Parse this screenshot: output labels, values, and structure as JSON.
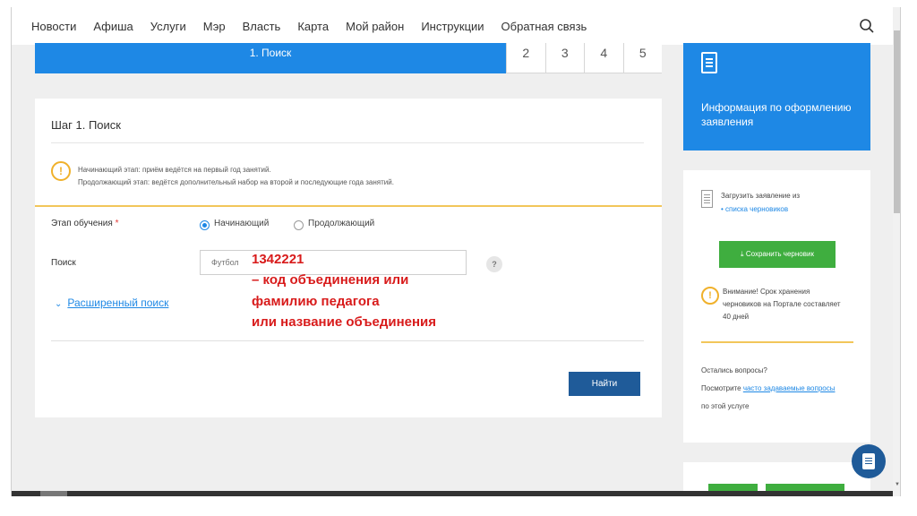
{
  "nav": {
    "items": [
      "Новости",
      "Афиша",
      "Услуги",
      "Мэр",
      "Власть",
      "Карта",
      "Мой район",
      "Инструкции",
      "Обратная связь"
    ]
  },
  "steps": {
    "active_label": "1. Поиск",
    "others": [
      "2",
      "3",
      "4",
      "5"
    ]
  },
  "form": {
    "title": "Шаг 1. Поиск",
    "info_icon": "!",
    "info_line1": "Начинающий этап: приём ведётся на первый год занятий.",
    "info_line2": "Продолжающий этап: ведётся дополнительный набор на второй и последующие года занятий.",
    "stage_label": "Этап обучения",
    "required_mark": "*",
    "stage_options": [
      "Начинающий",
      "Продолжающий"
    ],
    "stage_selected": "Начинающий",
    "search_label": "Поиск",
    "search_placeholder": "Футбол",
    "help_icon": "?",
    "advanced_search": "Расширенный поиск",
    "advanced_chevron": "⌄",
    "find_button": "Найти"
  },
  "annotation": {
    "line1": "1342221",
    "line2": "– код объединения или",
    "line3": "фамилию педагога",
    "line4": "или название объединения"
  },
  "sidebar": {
    "info_title": "Информация по оформлению заявления",
    "draft_text": "Загрузить заявление из",
    "draft_link": "списка черновиков",
    "save_button": "Сохранить черновик",
    "warn_icon": "!",
    "warn_line1": "Внимание! Срок хранения",
    "warn_line2": "черновиков на Портале составляет",
    "warn_line3": "40 дней",
    "questions": "Остались вопросы?",
    "see_prefix": "Посмотрите",
    "faq_link": "часто задаваемые вопросы",
    "about_service": "по этой услуге"
  },
  "colors": {
    "accent_blue": "#1e88e5",
    "dark_blue": "#1f5b99",
    "green": "#3fae3f",
    "warning_yellow": "#f0b12b",
    "annotation_red": "#d81b1b"
  }
}
